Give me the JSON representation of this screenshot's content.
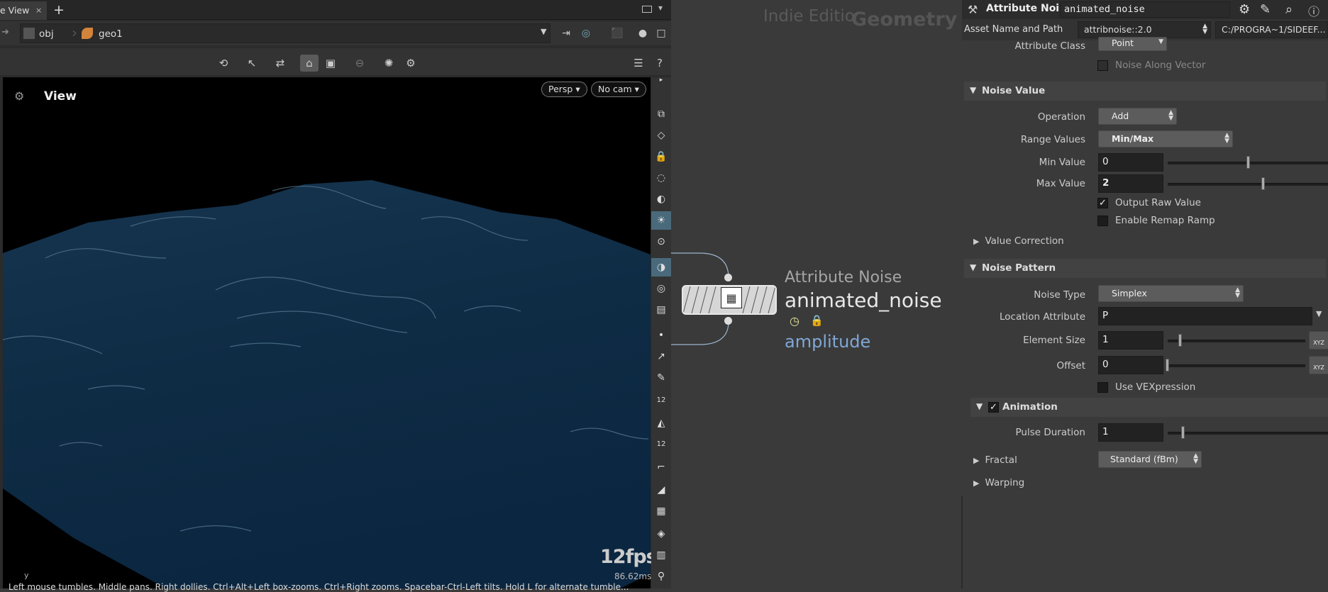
{
  "viewer_tab": {
    "label": "e View",
    "close": "×",
    "add": "+"
  },
  "path": {
    "obj": "obj",
    "geo": "geo1"
  },
  "viewport": {
    "title": "View",
    "persp": "Persp",
    "cam": "No cam",
    "fps": "12fps",
    "ms": "86.62ms",
    "axis": "y",
    "hint": "Left mouse tumbles. Middle pans. Right dollies. Ctrl+Alt+Left box-zooms. Ctrl+Right zooms. Spacebar-Ctrl-Left tilts. Hold L for alternate tumble..."
  },
  "network": {
    "indie": "Indie Editio",
    "context": "Geometry",
    "node_type": "Attribute Noise",
    "node_name": "animated_noise",
    "node_parm": "amplitude"
  },
  "parms": {
    "header_title": "Attribute Noise",
    "node_name": "animated_noise",
    "asset_label": "Asset Name and Path",
    "asset_name": "attribnoise::2.0",
    "asset_path": "C:/PROGRA~1/SIDEEF...",
    "attr_class_label": "Attribute Class",
    "attr_class_value": "Point",
    "noise_along_vector": "Noise Along Vector",
    "sect_noise_value": "Noise Value",
    "operation_label": "Operation",
    "operation_value": "Add",
    "range_label": "Range Values",
    "range_value": "Min/Max",
    "min_label": "Min Value",
    "min_value": "0",
    "max_label": "Max Value",
    "max_value": "2",
    "output_raw": "Output Raw Value",
    "enable_remap": "Enable Remap Ramp",
    "value_correction": "Value Correction",
    "sect_noise_pattern": "Noise Pattern",
    "noise_type_label": "Noise Type",
    "noise_type_value": "Simplex",
    "location_label": "Location Attribute",
    "location_value": "P",
    "element_size_label": "Element Size",
    "element_size_value": "1",
    "offset_label": "Offset",
    "offset_value": "0",
    "use_vex": "Use VEXpression",
    "sect_animation": "Animation",
    "pulse_label": "Pulse Duration",
    "pulse_value": "1",
    "fractal_label": "Fractal",
    "fractal_value": "Standard (fBm)",
    "warping_label": "Warping",
    "xyz": "XYZ"
  }
}
